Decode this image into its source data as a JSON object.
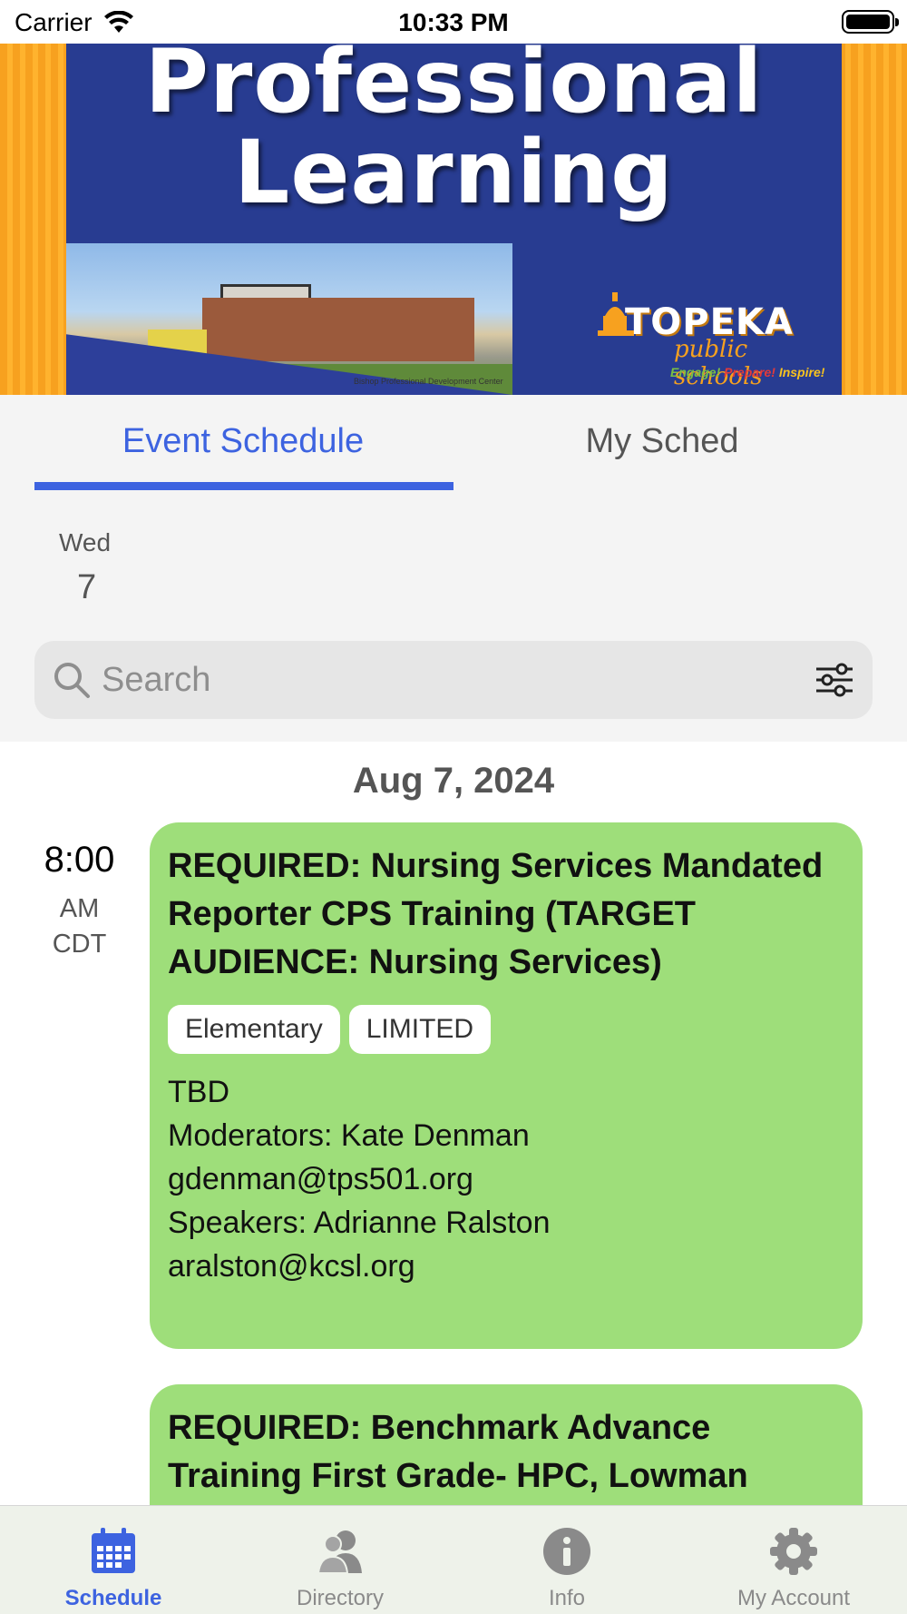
{
  "status_bar": {
    "carrier": "Carrier",
    "time": "10:33 PM"
  },
  "banner": {
    "title_line1": "Professional",
    "title_line2": "Learning",
    "logo_word": "TOPEKA",
    "logo_sub": "public schools",
    "tagline": [
      "Engage!",
      "Prepare!",
      "Inspire!"
    ],
    "photo_caption": "Bishop Professional Development Center"
  },
  "tabs": {
    "event_schedule": "Event Schedule",
    "my_schedule": "My Sched"
  },
  "day_picker": {
    "day_name": "Wed",
    "day_number": "7"
  },
  "search": {
    "placeholder": "Search"
  },
  "list": {
    "date_header": "Aug 7, 2024",
    "time": {
      "main": "8:00",
      "ampm": "AM",
      "tz": "CDT"
    },
    "events": [
      {
        "title": "REQUIRED: Nursing Services Mandated Reporter CPS Training (TARGET AUDIENCE: Nursing Services)",
        "tags": [
          "Elementary",
          "LIMITED"
        ],
        "location": "TBD",
        "moderators": "Moderators: Kate Denman",
        "moderator_email": "gdenman@tps501.org",
        "speakers": "Speakers: Adrianne Ralston",
        "speaker_email": "aralston@kcsl.org"
      },
      {
        "title": "REQUIRED: Benchmark Advance Training First Grade- HPC, Lowman"
      }
    ]
  },
  "tab_bar": {
    "items": [
      {
        "label": "Schedule",
        "icon": "calendar-icon",
        "active": true
      },
      {
        "label": "Directory",
        "icon": "people-icon",
        "active": false
      },
      {
        "label": "Info",
        "icon": "info-icon",
        "active": false
      },
      {
        "label": "My Account",
        "icon": "gear-icon",
        "active": false
      }
    ]
  },
  "colors": {
    "accent": "#3d63e0",
    "card": "#9ede7a",
    "banner_blue": "#283c91",
    "banner_orange": "#f7a11f"
  }
}
